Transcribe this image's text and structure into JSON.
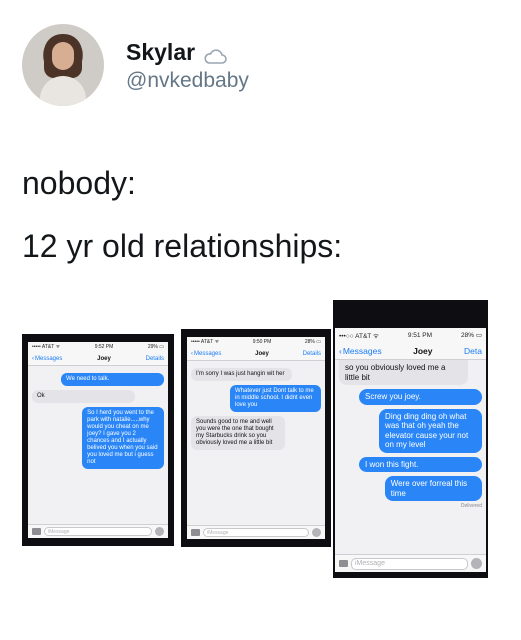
{
  "tweet": {
    "display_name": "Skylar",
    "handle": "@nvkedbaby",
    "line1": "nobody:",
    "line2": "12 yr old relationships:"
  },
  "screens": [
    {
      "status": {
        "carrier": "••••• AT&T ᯤ",
        "time": "9:52 PM",
        "battery": "29% ▭"
      },
      "nav": {
        "back": "Messages",
        "title": "Joey",
        "details": "Details"
      },
      "messages": [
        {
          "from": "me",
          "text": "We need to talk."
        },
        {
          "from": "them",
          "text": "Ok"
        },
        {
          "from": "me",
          "text": "So I herd you went to the park with natalie.....why would you cheat on me joey? I gave you 2 chances and I actually belived you when you said you loved me but i guess not"
        }
      ],
      "composer_placeholder": "iMessage"
    },
    {
      "status": {
        "carrier": "••••• AT&T ᯤ",
        "time": "9:50 PM",
        "battery": "28% ▭"
      },
      "nav": {
        "back": "Messages",
        "title": "Joey",
        "details": "Details"
      },
      "messages": [
        {
          "from": "them",
          "text": "I'm sorry I was just hangin wit her"
        },
        {
          "from": "me",
          "text": "Whatever just Dont talk to me in middle school. I didnt even love you"
        },
        {
          "from": "them",
          "text": "Sounds good to me and well you were the one that bought my Starbucks drink so you obviously loved me a little bit"
        }
      ],
      "composer_placeholder": "iMessage"
    },
    {
      "status": {
        "carrier": "•••○○ AT&T ᯤ",
        "time": "9:51 PM",
        "battery": "28% ▭"
      },
      "nav": {
        "back": "Messages",
        "title": "Joey",
        "details": "Deta"
      },
      "messages": [
        {
          "from": "them",
          "text": "so you obviously loved me a little bit"
        },
        {
          "from": "me",
          "text": "Screw you joey."
        },
        {
          "from": "me",
          "text": "Ding ding ding oh what was that oh yeah the elevator cause your not on my level"
        },
        {
          "from": "me",
          "text": "I won this fight."
        },
        {
          "from": "me",
          "text": "Were over forreal this time"
        }
      ],
      "delivered": "Delivered",
      "composer_placeholder": "iMessage"
    }
  ]
}
